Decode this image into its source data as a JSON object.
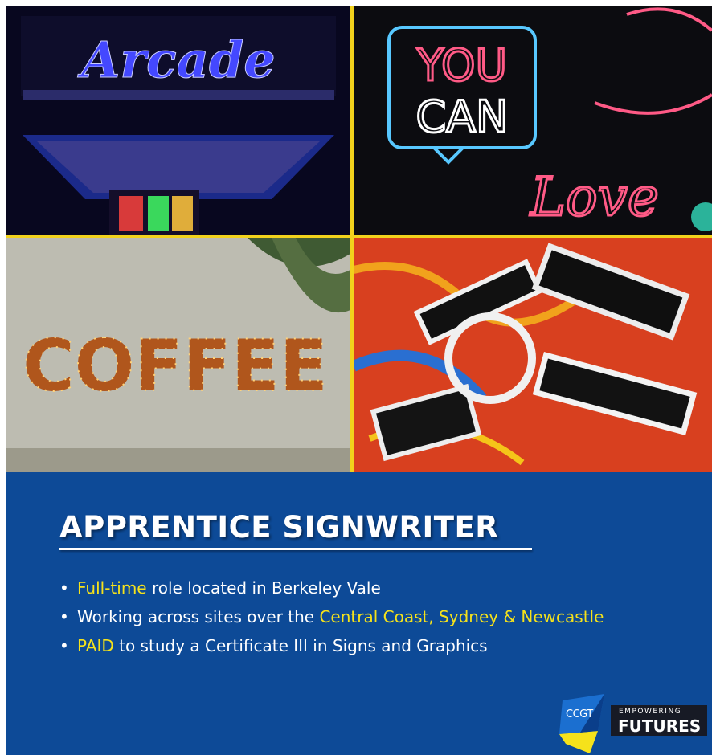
{
  "photos": {
    "arcade": {
      "sign_text": "Arcade",
      "sign_color": "#3a3dff"
    },
    "neon": {
      "line1": "YOU",
      "line2": "CAN",
      "script": "Love",
      "pink": "#ff5a86",
      "blue": "#58c8ff"
    },
    "coffee": {
      "sign_text": "COFFEE",
      "bulb_color": "#ffd27a"
    },
    "letters": {
      "background": "#d8401f"
    }
  },
  "heading": {
    "title": "APPRENTICE SIGNWRITER"
  },
  "bullets": [
    {
      "highlight": "Full-time",
      "text": " role located in Berkeley Vale",
      "prefix": ""
    },
    {
      "prefix": "Working across sites over the ",
      "highlight": "Central Coast, Sydney & Newcastle",
      "text": ""
    },
    {
      "highlight": "PAID",
      "text": " to study a Certificate III in Signs and Graphics",
      "prefix": ""
    }
  ],
  "logo": {
    "mark": "CCGT",
    "tagline": "EMPOWERING",
    "name": "FUTURES"
  },
  "colors": {
    "panel": "#0d4a97",
    "highlight": "#f5e21b",
    "frame": "#f2d21c"
  }
}
